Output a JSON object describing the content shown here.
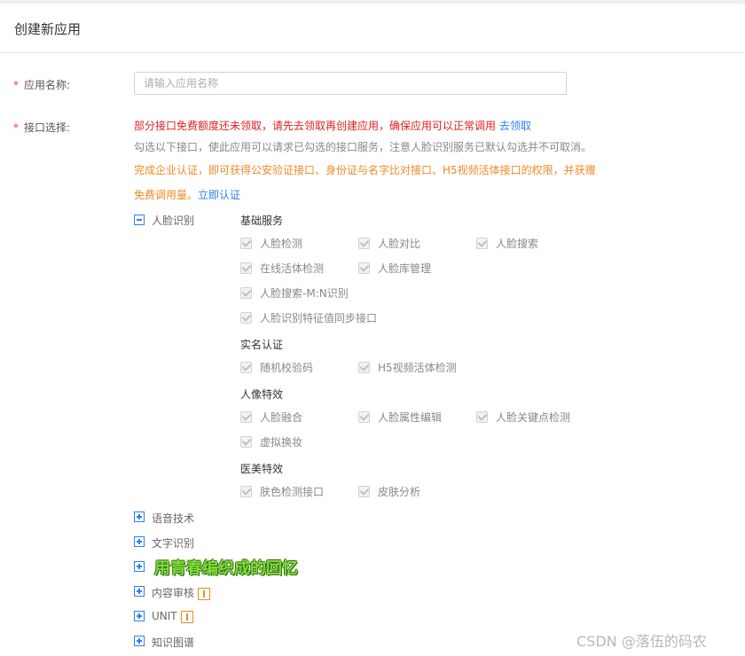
{
  "page": {
    "title": "创建新应用"
  },
  "form": {
    "name_label": "应用名称:",
    "name_placeholder": "请输入应用名称",
    "api_label": "接口选择:",
    "required_mark": "*"
  },
  "notice": {
    "red_text": "部分接口免费额度还未领取，请先去领取再创建应用，确保应用可以正常调用",
    "red_link": "去领取",
    "gray_text": "勾选以下接口，使此应用可以请求已勾选的接口服务，注意人脸识别服务已默认勾选并不可取消。",
    "orange_text_1": "完成企业认证，即可获得公安验证接口、身份证与名字比对接口、H5视频活体接口的权限，并获赠",
    "orange_text_2": "免费调用量。",
    "orange_link": "立即认证"
  },
  "face": {
    "label": "人脸识别",
    "groups": {
      "basic": {
        "title": "基础服务",
        "items": [
          "人脸检测",
          "人脸对比",
          "人脸搜索",
          "在线活体检测",
          "人脸库管理",
          "人脸搜索-M:N识别",
          "人脸识别特征值同步接口"
        ]
      },
      "realname": {
        "title": "实名认证",
        "items": [
          "随机校验码",
          "H5视频活体检测"
        ]
      },
      "effects": {
        "title": "人像特效",
        "items": [
          "人脸融合",
          "人脸属性编辑",
          "人脸关键点检测",
          "虚拟换妆"
        ]
      },
      "beauty": {
        "title": "医美特效",
        "items": [
          "肤色检测接口",
          "皮肤分析"
        ]
      }
    }
  },
  "categories": {
    "speech": "语音技术",
    "ocr": "文字识别",
    "hidden": "",
    "content": "内容审核",
    "unit": "UNIT",
    "kg": "知识图谱"
  },
  "overlay": "用青春编织成的回忆",
  "watermark": "CSDN @落伍的码农"
}
